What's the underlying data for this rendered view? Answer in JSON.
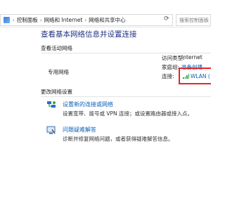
{
  "address_bar": {
    "segments": [
      "控制面板",
      "网络和 Internet",
      "网络和共享中心"
    ],
    "search_placeholder": "搜索控制面板"
  },
  "main": {
    "title": "查看基本网络信息并设置连接",
    "active_networks_heading": "查看活动网络",
    "network_name": "专用网络",
    "details": {
      "access_type_label": "访问类型:",
      "access_type_value": "Internet",
      "homegroup_label": "家庭组:",
      "homegroup_value": "准备创建",
      "connections_label": "连接:",
      "connections_value": "WLAN ("
    },
    "change_settings_heading": "更改网络设置",
    "tasks": [
      {
        "link": "设置新的连接或网络",
        "desc": "设置宽带、拨号或 VPN 连接；或设置路由器或接入点。",
        "icon": "new-connection-icon"
      },
      {
        "link": "问题疑难解答",
        "desc": "诊断并修复网络问题，或者获得疑难解答信息。",
        "icon": "troubleshoot-icon"
      }
    ]
  },
  "colors": {
    "title_blue": "#1e3287",
    "link_blue": "#0a5fb4",
    "highlight_red": "#e8242a",
    "signal_green": "#2ea043"
  }
}
